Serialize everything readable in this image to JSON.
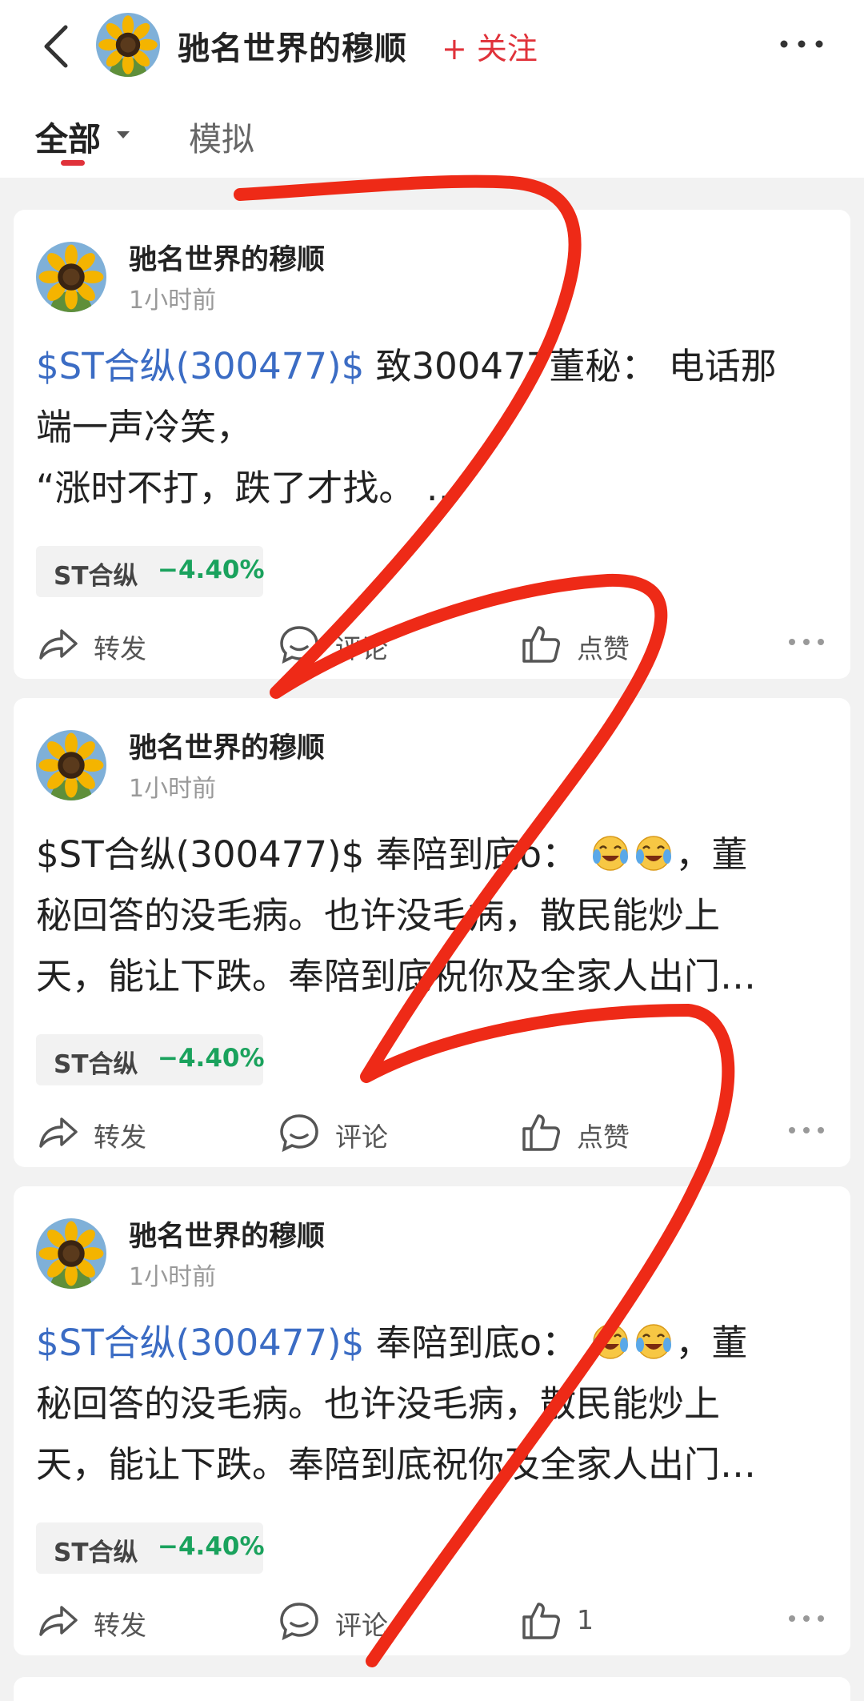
{
  "header": {
    "title": "驰名世界的穆顺",
    "follow_label": "+ 关注",
    "tabs": [
      {
        "label": "全部",
        "active": true
      },
      {
        "label": "模拟",
        "active": false
      }
    ]
  },
  "posts": [
    {
      "author": "驰名世界的穆顺",
      "time": "1小时前",
      "stock_tag": "$ST合纵(300477)$",
      "text_line1": "致300477董秘：  电话那",
      "text_line2": "端一声冷笑，",
      "text_line3": "“涨时不打，跌了才找。 …",
      "stock_name": "ST合纵",
      "stock_change": "−4.40%",
      "forward_label": "转发",
      "comment_label": "评论",
      "like_label": "点赞"
    },
    {
      "author": "驰名世界的穆顺",
      "time": "1小时前",
      "stock_tag": "$ST合纵(300477)$",
      "text_line1a": "奉陪到底o：",
      "text_line1b": "，董",
      "text_line2": "秘回答的没毛病。也许没毛病，散民能炒上",
      "text_line3": "天，能让下跌。奉陪到底祝你及全家人出门…",
      "stock_name": "ST合纵",
      "stock_change": "−4.40%",
      "forward_label": "转发",
      "comment_label": "评论",
      "like_label": "点赞"
    },
    {
      "author": "驰名世界的穆顺",
      "time": "1小时前",
      "stock_tag": "$ST合纵(300477)$",
      "text_line1a": "奉陪到底o：",
      "text_line1b": "，董",
      "text_line2": "秘回答的没毛病。也许没毛病，散民能炒上",
      "text_line3": "天，能让下跌。奉陪到底祝你及全家人出门…",
      "stock_name": "ST合纵",
      "stock_change": "−4.40%",
      "forward_label": "转发",
      "comment_label": "评论",
      "like_label": "1"
    }
  ],
  "colors": {
    "accent_red": "#e0323a",
    "link_blue": "#3b6cc4",
    "stock_down_green": "#1aa25d",
    "scribble_red": "#ee2a17"
  },
  "icons": [
    "back-arrow-icon",
    "sunflower-avatar",
    "more-dots-icon",
    "forward-icon",
    "comment-icon",
    "like-icon",
    "laughing-crying-emoji"
  ]
}
